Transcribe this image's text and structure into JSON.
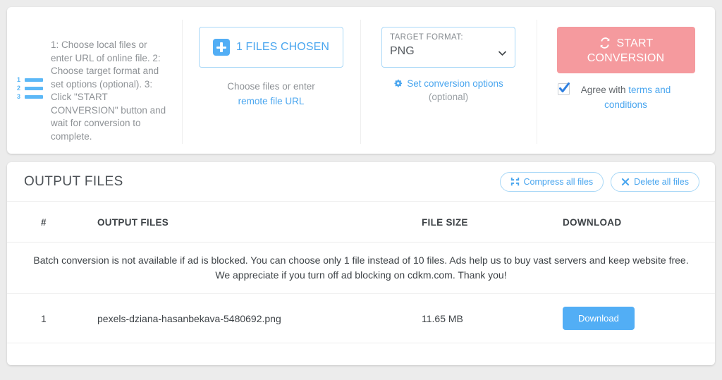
{
  "converter": {
    "instructions": {
      "icon": "numbered-list-icon",
      "text": "1: Choose local files or enter URL of online file. 2: Choose target format and set options (optional). 3: Click \"START CONVERSION\" button and wait for conversion to complete."
    },
    "files": {
      "button_icon": "plus-square-icon",
      "button_label": "1 FILES CHOSEN",
      "hint_prefix": "Choose files or enter ",
      "hint_link": "remote file URL"
    },
    "format": {
      "label": "TARGET FORMAT:",
      "value": "PNG",
      "chevron_icon": "chevron-down-icon",
      "options_icon": "gear-icon",
      "options_link": "Set conversion options",
      "optional_note": "(optional)"
    },
    "start": {
      "icon": "sync-refresh-icon",
      "label_line1": "START",
      "label_line2": "CONVERSION",
      "button_color": "#f59a9e",
      "agree_prefix": "Agree with ",
      "agree_link": "terms and conditions",
      "agree_checked": true,
      "check_icon": "checkmark-icon"
    }
  },
  "output": {
    "title": "OUTPUT FILES",
    "actions": [
      {
        "label": "Compress all files",
        "icon": "compress-icon"
      },
      {
        "label": "Delete all files",
        "icon": "close-x-icon"
      }
    ],
    "columns": [
      "#",
      "OUTPUT FILES",
      "FILE SIZE",
      "DOWNLOAD"
    ],
    "warning": "Batch conversion is not available if ad is blocked. You can choose only 1 file instead of 10 files. Ads help us to buy vast servers and keep website free. We appreciate if you turn off ad blocking on cdkm.com. Thank you!",
    "warning_color": "#f4787c",
    "rows": [
      {
        "index": "1",
        "name": "pexels-dziana-hasanbekava-5480692.png",
        "size": "11.65 MB",
        "download_label": "Download"
      }
    ]
  },
  "colors": {
    "accent_blue": "#52aef5",
    "link_blue": "#4aa6ef",
    "page_bg": "#ececec",
    "card_bg": "#ffffff"
  }
}
